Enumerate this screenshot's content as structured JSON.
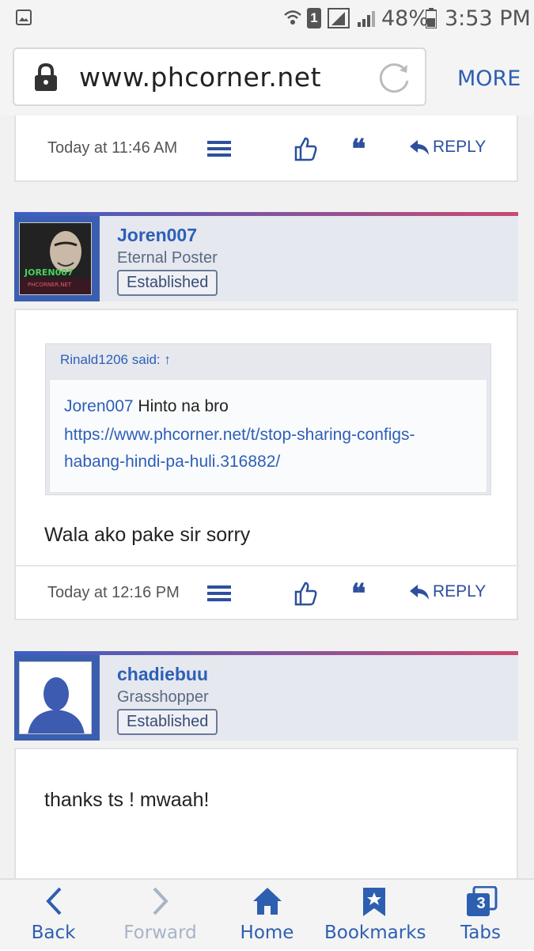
{
  "status_bar": {
    "battery": "48%",
    "time": "3:53 PM",
    "sim_slot": "1"
  },
  "browser": {
    "url": "www.phcorner.net",
    "more_label": "MORE"
  },
  "posts": [
    {
      "time": "Today at 11:46 AM",
      "reply_label": "REPLY"
    },
    {
      "username": "Joren007",
      "user_title": "Eternal Poster",
      "badge": "Established",
      "avatar_text": "JOREN007",
      "avatar_subtext": "PHCORNER.NET",
      "quote": {
        "header": "Rinald1206 said: ↑",
        "mention": "Joren007",
        "text": "Hinto na bro",
        "link_line1": "https://www.phcorner.net/t/stop-sharing-configs-",
        "link_line2": "habang-hindi-pa-huli.316882/"
      },
      "message": "Wala ako pake sir sorry",
      "time": "Today at 12:16 PM",
      "reply_label": "REPLY"
    },
    {
      "username": "chadiebuu",
      "user_title": "Grasshopper",
      "badge": "Established",
      "message": "thanks ts ! mwaah!"
    }
  ],
  "bottom_nav": {
    "back": "Back",
    "forward": "Forward",
    "home": "Home",
    "bookmarks": "Bookmarks",
    "tabs": "Tabs",
    "tabs_count": "3"
  },
  "colors": {
    "accent": "#2d5fb0",
    "icon_blue": "#2d4f9e",
    "header_bg": "#e5e8ee"
  }
}
